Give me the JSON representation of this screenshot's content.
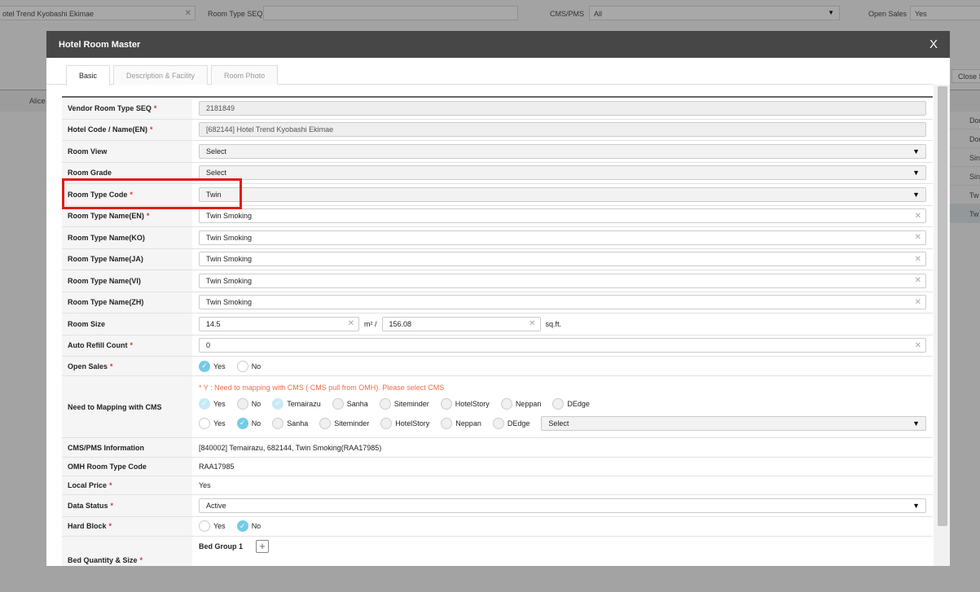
{
  "background": {
    "hotel_value": "otel Trend Kyobashi Ekimae",
    "room_type_seq_label": "Room Type SEQ",
    "cms_pms_label": "CMS/PMS",
    "cms_pms_value": "All",
    "open_sales_label": "Open Sales",
    "open_sales_value": "Yes",
    "close_label": "Close S",
    "col_label": "Alice",
    "rows": [
      "Dou",
      "Dou",
      "Sin",
      "Sin",
      "Tw",
      "Tw"
    ]
  },
  "modal": {
    "title": "Hotel Room Master",
    "close": "X",
    "tabs": [
      "Basic",
      "Description & Facility",
      "Room Photo"
    ],
    "fields": {
      "vendor_seq": {
        "label": "Vendor Room Type SEQ",
        "value": "2181849"
      },
      "hotel_code": {
        "label": "Hotel Code / Name(EN)",
        "value": "[682144] Hotel Trend Kyobashi Ekimae"
      },
      "room_view": {
        "label": "Room View",
        "value": "Select"
      },
      "room_grade": {
        "label": "Room Grade",
        "value": "Select"
      },
      "room_type_code": {
        "label": "Room Type Code",
        "value": "Twin"
      },
      "name_en": {
        "label": "Room Type Name(EN)",
        "value": "Twin Smoking"
      },
      "name_ko": {
        "label": "Room Type Name(KO)",
        "value": "Twin Smoking"
      },
      "name_ja": {
        "label": "Room Type Name(JA)",
        "value": "Twin Smoking"
      },
      "name_vi": {
        "label": "Room Type Name(VI)",
        "value": "Twin Smoking"
      },
      "name_zh": {
        "label": "Room Type Name(ZH)",
        "value": "Twin Smoking"
      },
      "room_size": {
        "label": "Room Size",
        "value_m2": "14.5",
        "unit_m2": "m² /",
        "value_sqft": "156.08",
        "unit_sqft": "sq.ft."
      },
      "auto_refill": {
        "label": "Auto Refill Count",
        "value": "0"
      },
      "open_sales": {
        "label": "Open Sales",
        "yes": "Yes",
        "no": "No",
        "selected": "Yes"
      },
      "mapping": {
        "label": "Need to Mapping with CMS",
        "note": "* Y : Need to mapping with CMS ( CMS pull from OMH). Please select CMS",
        "yes": "Yes",
        "no": "No",
        "row1_cms": [
          "Temairazu",
          "Sanha",
          "Siteminder",
          "HotelStory",
          "Neppan",
          "DEdge"
        ],
        "row2_cms": [
          "Sanha",
          "Siteminder",
          "HotelStory",
          "Neppan",
          "DEdge"
        ],
        "row2_select": "Select"
      },
      "cms_info": {
        "label": "CMS/PMS Information",
        "value": "[840002] Temairazu, 682144, Twin Smoking(RAA17985)"
      },
      "omh_code": {
        "label": "OMH Room Type Code",
        "value": "RAA17985"
      },
      "local_price": {
        "label": "Local Price",
        "value": "Yes"
      },
      "data_status": {
        "label": "Data Status",
        "value": "Active"
      },
      "hard_block": {
        "label": "Hard Block",
        "yes": "Yes",
        "no": "No",
        "selected": "No"
      },
      "bed": {
        "label": "Bed Quantity & Size",
        "group": "Bed Group 1"
      }
    }
  },
  "required_mark": "*"
}
